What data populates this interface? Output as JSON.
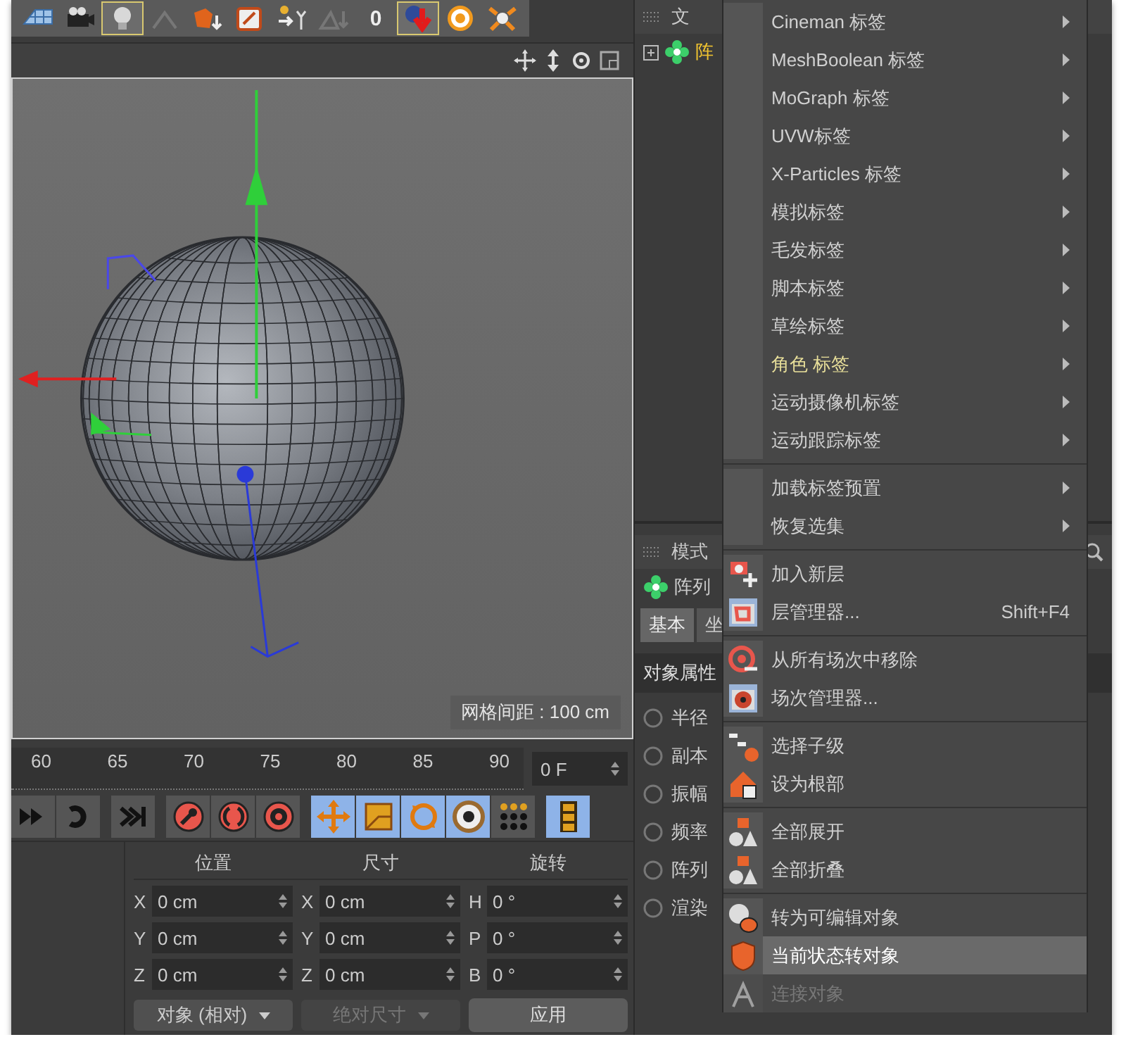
{
  "toolbar": {
    "buttons": [
      {
        "selected": false
      },
      {
        "selected": false
      },
      {
        "selected": true
      },
      {
        "selected": false
      },
      {
        "selected": false
      },
      {
        "selected": false
      },
      {
        "selected": false
      },
      {
        "selected": false
      },
      {
        "label": "0",
        "selected": false
      },
      {
        "selected": true
      },
      {
        "selected": false
      },
      {
        "selected": false
      }
    ]
  },
  "viewport": {
    "grid_spacing": "网格间距 : 100 cm"
  },
  "timeline": {
    "ticks": [
      "60",
      "65",
      "70",
      "75",
      "80",
      "85",
      "90"
    ],
    "frame_field": "0 F"
  },
  "playback": {
    "buttons": [
      {
        "selected": false
      },
      {
        "selected": false
      },
      {
        "selected": false
      },
      {
        "selected": false
      },
      {
        "selected": false
      },
      {
        "selected": false
      },
      {
        "selected": true
      },
      {
        "selected": true
      },
      {
        "selected": true
      },
      {
        "selected": true
      },
      {
        "selected": false
      },
      {
        "selected": true
      }
    ]
  },
  "coordinates": {
    "columns": [
      "位置",
      "尺寸",
      "旋转"
    ],
    "rows": [
      {
        "axis": "X",
        "position": "0 cm",
        "size_axis": "X",
        "size": "0 cm",
        "rotation_axis": "H",
        "rotation": "0 °"
      },
      {
        "axis": "Y",
        "position": "0 cm",
        "size_axis": "Y",
        "size": "0 cm",
        "rotation_axis": "P",
        "rotation": "0 °"
      },
      {
        "axis": "Z",
        "position": "0 cm",
        "size_axis": "Z",
        "size": "0 cm",
        "rotation_axis": "B",
        "rotation": "0 °"
      }
    ],
    "mode_dropdown": "对象 (相对)",
    "size_dropdown": {
      "label": "绝对尺寸",
      "disabled": true
    },
    "apply_button": "应用"
  },
  "object_manager": {
    "menu": [
      "文"
    ],
    "objects": [
      {
        "name": "阵",
        "selected": true
      }
    ]
  },
  "attribute_manager": {
    "menu": [
      "模式"
    ],
    "object_name": "阵列",
    "tabs": [
      {
        "label": "基本",
        "selected": true
      },
      {
        "label": "坐",
        "selected": false
      }
    ],
    "section": "对象属性",
    "fields": [
      "半径",
      "副本",
      "振幅",
      "频率",
      "阵列",
      "渲染"
    ]
  },
  "context_menu": {
    "groups": [
      {
        "items": [
          {
            "label": "Cineman 标签",
            "kind": "submenu",
            "emphasized": false,
            "selected": false,
            "disabled": false
          },
          {
            "label": "MeshBoolean 标签",
            "kind": "submenu",
            "emphasized": false,
            "selected": false,
            "disabled": false
          },
          {
            "label": "MoGraph 标签",
            "kind": "submenu",
            "emphasized": false,
            "selected": false,
            "disabled": false
          },
          {
            "label": "UVW标签",
            "kind": "submenu",
            "emphasized": false,
            "selected": false,
            "disabled": false
          },
          {
            "label": "X-Particles 标签",
            "kind": "submenu",
            "emphasized": false,
            "selected": false,
            "disabled": false
          },
          {
            "label": "模拟标签",
            "kind": "submenu",
            "emphasized": false,
            "selected": false,
            "disabled": false
          },
          {
            "label": "毛发标签",
            "kind": "submenu",
            "emphasized": false,
            "selected": false,
            "disabled": false
          },
          {
            "label": "脚本标签",
            "kind": "submenu",
            "emphasized": false,
            "selected": false,
            "disabled": false
          },
          {
            "label": "草绘标签",
            "kind": "submenu",
            "emphasized": false,
            "selected": false,
            "disabled": false
          },
          {
            "label": "角色 标签",
            "kind": "submenu",
            "emphasized": true,
            "selected": false,
            "disabled": false
          },
          {
            "label": "运动摄像机标签",
            "kind": "submenu",
            "emphasized": false,
            "selected": false,
            "disabled": false
          },
          {
            "label": "运动跟踪标签",
            "kind": "submenu",
            "emphasized": false,
            "selected": false,
            "disabled": false
          }
        ]
      },
      {
        "items": [
          {
            "label": "加载标签预置",
            "kind": "submenu",
            "emphasized": false,
            "selected": false,
            "disabled": false
          },
          {
            "label": "恢复选集",
            "kind": "submenu",
            "emphasized": false,
            "selected": false,
            "disabled": false
          }
        ]
      },
      {
        "items": [
          {
            "label": "加入新层",
            "kind": "command",
            "emphasized": false,
            "selected": false,
            "disabled": false
          },
          {
            "label": "层管理器...",
            "kind": "command",
            "shortcut": "Shift+F4",
            "emphasized": false,
            "selected": false,
            "disabled": false
          }
        ]
      },
      {
        "items": [
          {
            "label": "从所有场次中移除",
            "kind": "command",
            "emphasized": false,
            "selected": false,
            "disabled": false
          },
          {
            "label": "场次管理器...",
            "kind": "command",
            "emphasized": false,
            "selected": false,
            "disabled": false
          }
        ]
      },
      {
        "items": [
          {
            "label": "选择子级",
            "kind": "command",
            "emphasized": false,
            "selected": false,
            "disabled": false
          },
          {
            "label": "设为根部",
            "kind": "command",
            "emphasized": false,
            "selected": false,
            "disabled": false
          }
        ]
      },
      {
        "items": [
          {
            "label": "全部展开",
            "kind": "command",
            "emphasized": false,
            "selected": false,
            "disabled": false
          },
          {
            "label": "全部折叠",
            "kind": "command",
            "emphasized": false,
            "selected": false,
            "disabled": false
          }
        ]
      },
      {
        "items": [
          {
            "label": "转为可编辑对象",
            "kind": "command",
            "emphasized": false,
            "selected": false,
            "disabled": false
          },
          {
            "label": "当前状态转对象",
            "kind": "command",
            "emphasized": false,
            "selected": true,
            "disabled": false
          },
          {
            "label": "连接对象",
            "kind": "command",
            "emphasized": false,
            "selected": false,
            "disabled": true
          }
        ]
      }
    ]
  }
}
